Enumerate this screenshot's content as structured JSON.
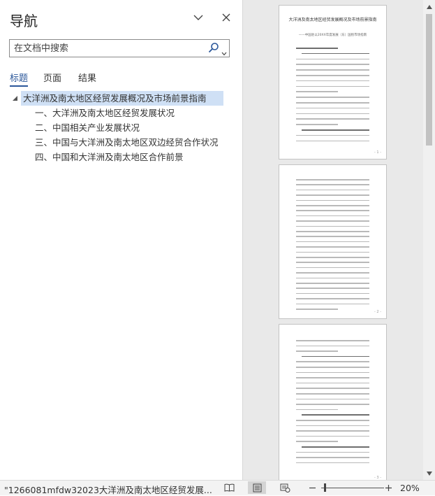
{
  "nav": {
    "title": "导航",
    "search_placeholder": "在文档中搜索",
    "tabs": [
      "标题",
      "页面",
      "结果"
    ],
    "tree": [
      {
        "label": "大洋洲及南太地区经贸发展概况及市场前景指南",
        "level": 0,
        "selected": true
      },
      {
        "label": "一、大洋洲及南太地区经贸发展状况",
        "level": 1,
        "selected": false
      },
      {
        "label": "二、中国相关产业发展状况",
        "level": 1,
        "selected": false
      },
      {
        "label": "三、中国与大洋洲及南太地区双边经贸合作状况",
        "level": 1,
        "selected": false
      },
      {
        "label": "四、中国和大洋洲及南太地区合作前景",
        "level": 1,
        "selected": false
      }
    ]
  },
  "thumbnails": {
    "page1_title": "大洋洲及南太地区经贸发展概况及市场前景指南",
    "page1_subtitle": "——中国驻以20XX年度发展（东）国别市场指南",
    "page_numbers": [
      "- 1 -",
      "- 2 -",
      "- 3 -"
    ]
  },
  "status": {
    "filename": "\"1266081mfdw32023大洋洲及南太地区经贸发展...",
    "zoom": "20%",
    "zoom_level_percent": 20
  },
  "colors": {
    "accent": "#2b579a",
    "selection": "#cfe0f5"
  }
}
